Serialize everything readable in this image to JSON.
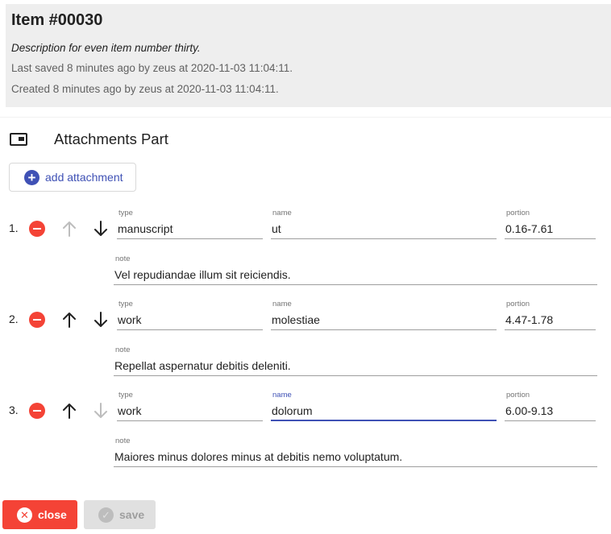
{
  "header": {
    "title": "Item #00030",
    "description": "Description for even item number thirty.",
    "last_saved": "Last saved 8 minutes ago by zeus at 2020-11-03 11:04:11.",
    "created": "Created 8 minutes ago by zeus at 2020-11-03 11:04:11."
  },
  "part": {
    "title": "Attachments Part",
    "icon": "attachment-part-icon"
  },
  "add_button": {
    "label": "add attachment",
    "icon": "add-circle-icon"
  },
  "labels": {
    "type": "type",
    "name": "name",
    "portion": "portion",
    "note": "note"
  },
  "attachments": [
    {
      "index": "1.",
      "type": "manuscript",
      "name": "ut",
      "portion": "0.16-7.61",
      "note": "Vel repudiandae illum sit reiciendis.",
      "can_move_up": false,
      "can_move_down": true,
      "name_focused": false
    },
    {
      "index": "2.",
      "type": "work",
      "name": "molestiae",
      "portion": "4.47-1.78",
      "note": "Repellat aspernatur debitis deleniti.",
      "can_move_up": true,
      "can_move_down": true,
      "name_focused": false
    },
    {
      "index": "3.",
      "type": "work",
      "name": "dolorum",
      "portion": "6.00-9.13",
      "note": "Maiores minus dolores minus at debitis nemo voluptatum.",
      "can_move_up": true,
      "can_move_down": false,
      "name_focused": true
    }
  ],
  "footer": {
    "close_label": "close",
    "save_label": "save",
    "save_enabled": false
  },
  "colors": {
    "accent": "#3f51b5",
    "danger": "#f44336",
    "header_bg": "#eeeeee",
    "disabled_bg": "#e0e0e0"
  }
}
